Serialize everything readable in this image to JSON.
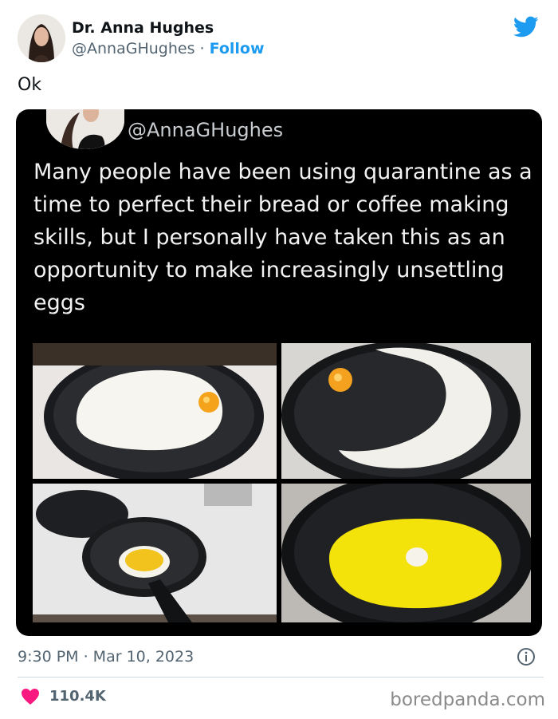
{
  "author": {
    "name": "Dr. Anna Hughes",
    "handle": "@AnnaGHughes",
    "separator": "·",
    "follow_label": "Follow"
  },
  "tweet": {
    "text": "Ok"
  },
  "quoted_tweet": {
    "handle": "@AnnaGHughes",
    "text": "Many people have been using quarantine as a time to perfect their bread or coffee making skills, but I personally have taken this as an opportunity to make increasingly unsettling eggs"
  },
  "meta": {
    "timestamp": "9:30 PM · Mar 10, 2023",
    "likes": "110.4K"
  },
  "watermark": "boredpanda.com",
  "icons": [
    "twitter-bird-icon",
    "info-icon",
    "heart-icon"
  ],
  "colors": {
    "brand_blue": "#1d9bf0",
    "heart_red": "#f91880",
    "muted": "#536471",
    "card_bg": "#000000"
  }
}
